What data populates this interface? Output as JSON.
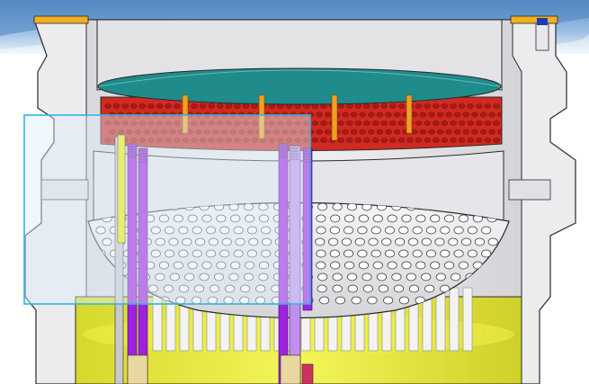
{
  "figure": {
    "subject": "reactor-vessel-cutaway",
    "colors": {
      "banner_blue": "#6f9fd3",
      "banner_light": "#cfe0f2",
      "vessel_gray": "#e9e9ec",
      "vessel_shadow": "#c9c9ce",
      "outline": "#2a2a2a",
      "plate_teal": "#1f8b8b",
      "plate_red": "#d02a22",
      "rod_orange": "#f0a020",
      "tube_purple": "#a020e0",
      "tube_yellow": "#f0f000",
      "barrel_yellow": "#e9ea3a",
      "highlight_cyan": "#2db6e6",
      "highlight_fill": "#ddeef9"
    },
    "highlight_box": {
      "present": true
    }
  }
}
